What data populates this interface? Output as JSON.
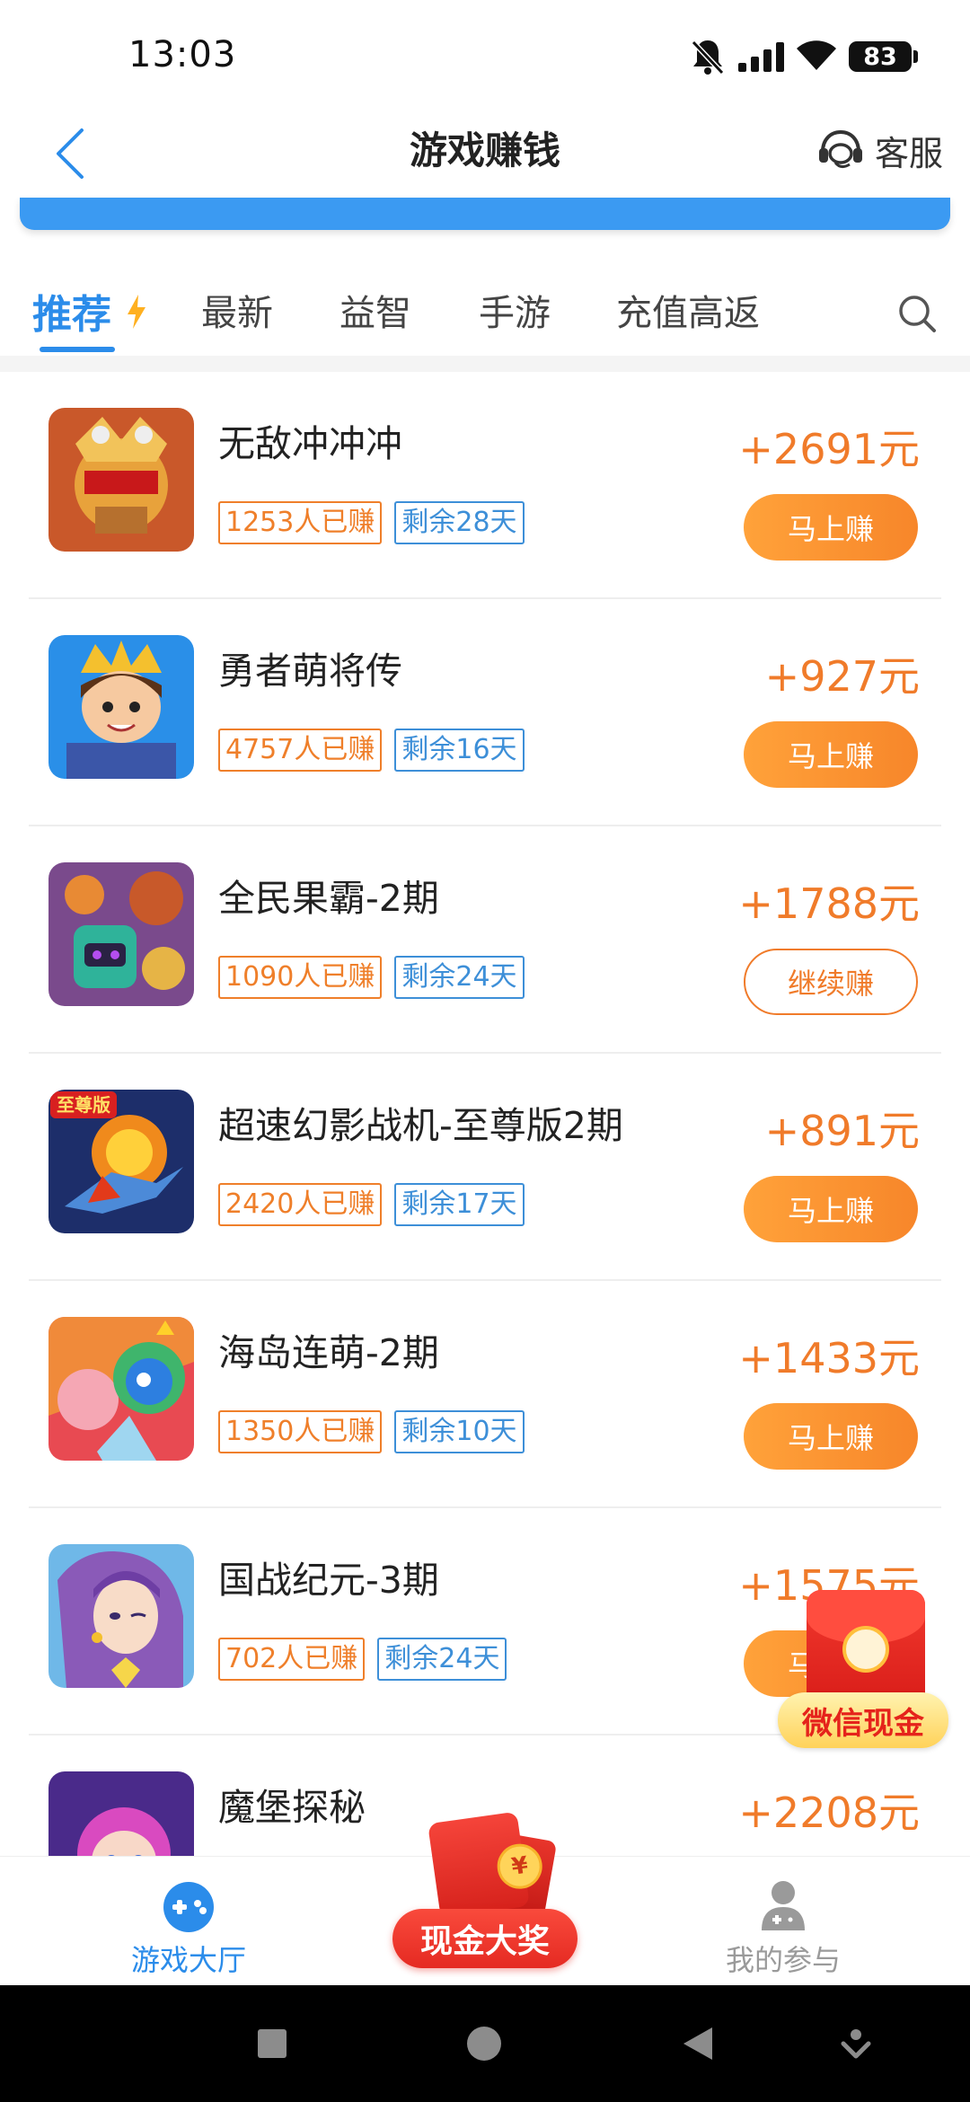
{
  "status_bar": {
    "time": "13:03",
    "battery": "83"
  },
  "header": {
    "title": "游戏赚钱",
    "service_label": "客服"
  },
  "tabs": [
    "推荐",
    "最新",
    "益智",
    "手游",
    "充值高返"
  ],
  "games": [
    {
      "name": "无敌冲冲冲",
      "earned": "1253人已赚",
      "remaining": "剩余28天",
      "reward": "+2691元",
      "button": "马上赚",
      "button_style": "primary"
    },
    {
      "name": "勇者萌将传",
      "earned": "4757人已赚",
      "remaining": "剩余16天",
      "reward": "+927元",
      "button": "马上赚",
      "button_style": "primary"
    },
    {
      "name": "全民果霸-2期",
      "earned": "1090人已赚",
      "remaining": "剩余24天",
      "reward": "+1788元",
      "button": "继续赚",
      "button_style": "outline"
    },
    {
      "name": "超速幻影战机-至尊版2期",
      "earned": "2420人已赚",
      "remaining": "剩余17天",
      "reward": "+891元",
      "button": "马上赚",
      "button_style": "primary",
      "icon_badge": "至尊版"
    },
    {
      "name": "海岛连萌-2期",
      "earned": "1350人已赚",
      "remaining": "剩余10天",
      "reward": "+1433元",
      "button": "马上赚",
      "button_style": "primary"
    },
    {
      "name": "国战纪元-3期",
      "earned": "702人已赚",
      "remaining": "剩余24天",
      "reward": "+1575元",
      "button": "马上赚",
      "button_style": "primary"
    },
    {
      "name": "魔堡探秘",
      "reward": "+2208元"
    }
  ],
  "floating_promo": {
    "label": "微信现金"
  },
  "bottom_nav": {
    "hall": "游戏大厅",
    "cash_prize": "现金大奖",
    "mine": "我的参与",
    "coin_symbol": "¥"
  },
  "colors": {
    "accent_blue": "#2b8cea",
    "reward_orange": "#f07b2a",
    "tag_blue": "#3d8fd8"
  }
}
